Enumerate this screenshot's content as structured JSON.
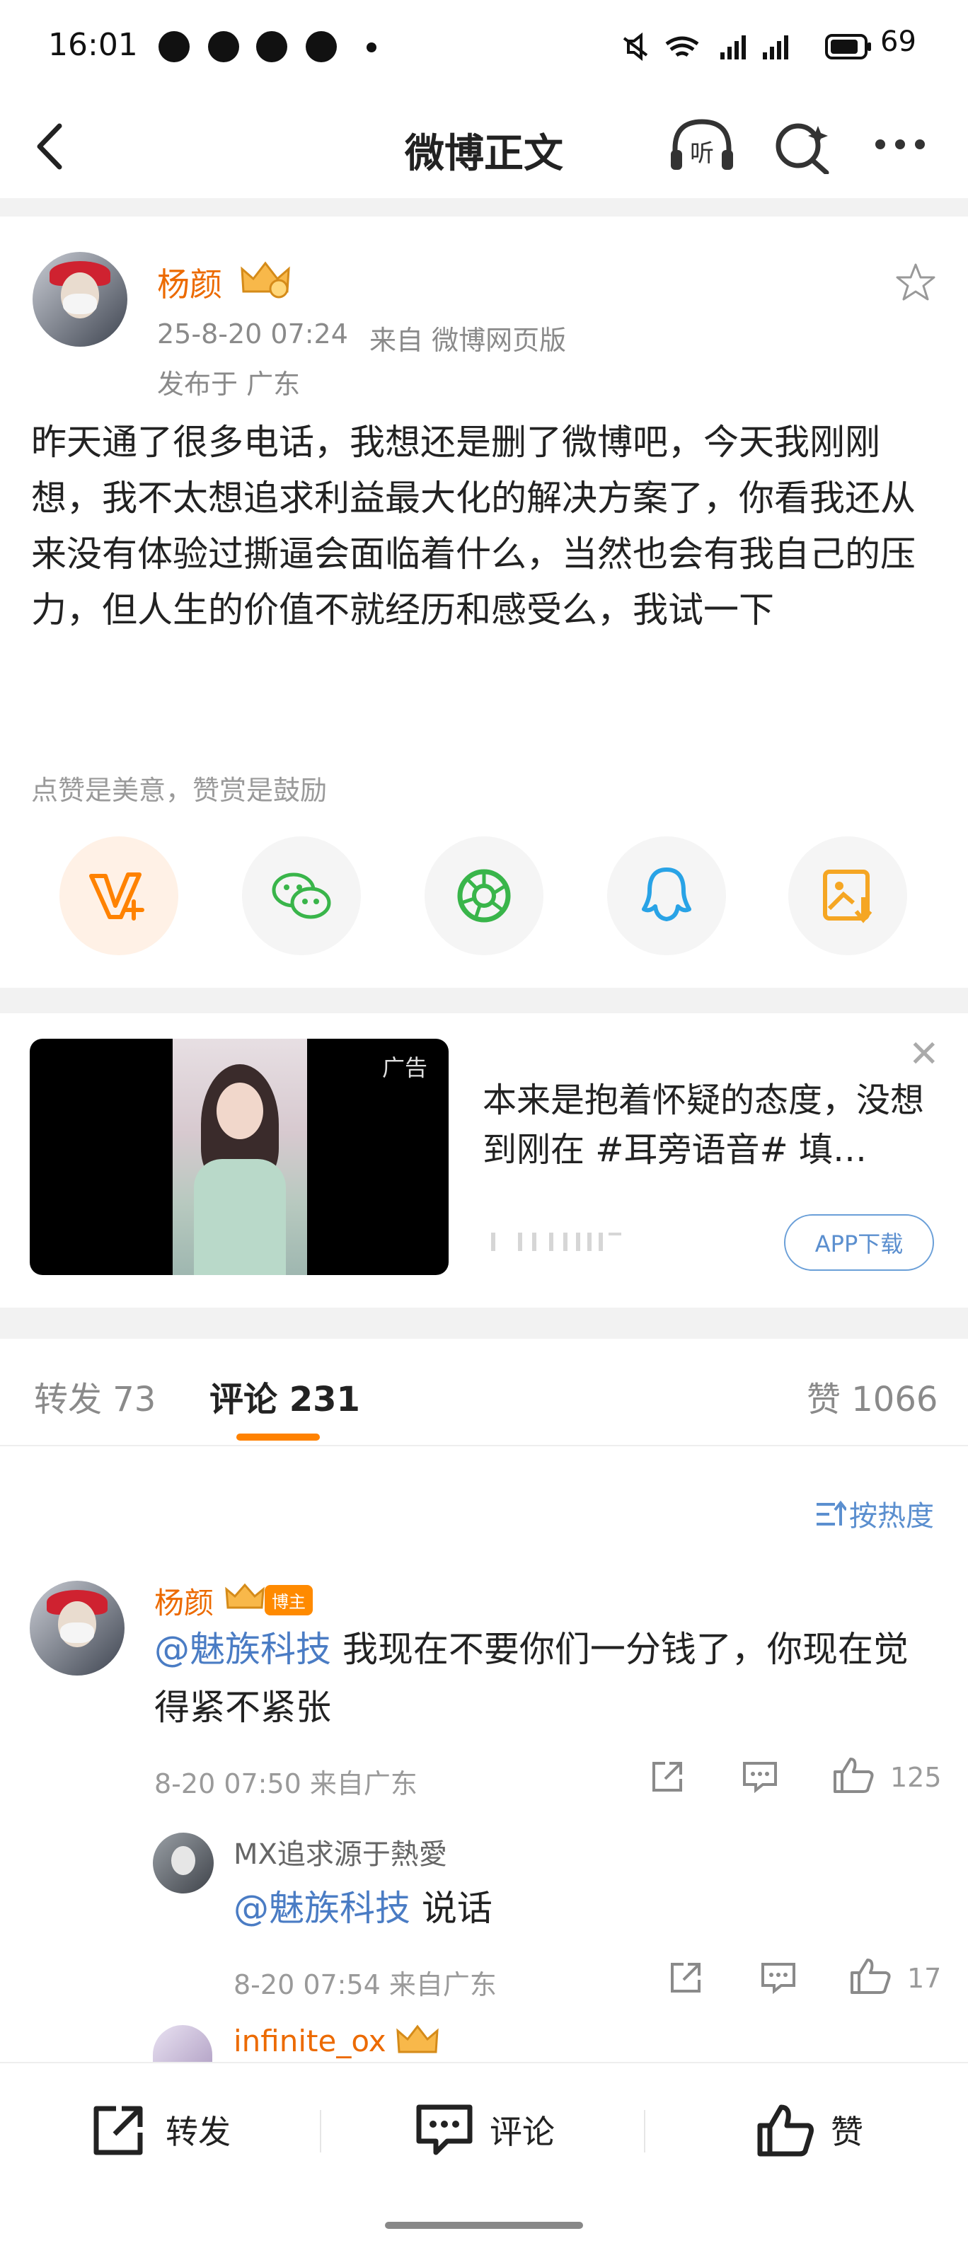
{
  "status_bar": {
    "time": "16:01",
    "battery": "69"
  },
  "nav": {
    "title": "微博正文"
  },
  "post": {
    "username": "杨颜",
    "datetime": "25-8-20 07:24",
    "source": "来自 微博网页版",
    "location": "发布于 广东",
    "content": "昨天通了很多电话，我想还是删了微博吧，今天我刚刚想，我不太想追求利益最大化的解决方案了，你看我还从来没有体验过撕逼会面临着什么，当然也会有我自己的压力，但人生的价值不就经历和感受么，我试一下",
    "reward_tip": "点赞是美意，赞赏是鼓励"
  },
  "ad": {
    "label": "广告",
    "text": "本来是抱着怀疑的态度，没想到刚在 #耳旁语音# 填…",
    "button": "APP下载"
  },
  "tabs": {
    "repost": "转发 73",
    "comment": "评论 231",
    "like": "赞 1066"
  },
  "sort_label": "按热度",
  "comments": [
    {
      "username": "杨颜",
      "badge": "博主",
      "mention": "@魅族科技",
      "text": " 我现在不要你们一分钱了，你现在觉得紧不紧张",
      "meta": "8-20 07:50  来自广东",
      "likes": "125"
    },
    {
      "username": "MX追求源于熱愛",
      "mention": "@魅族科技",
      "text": " 说话",
      "meta": "8-20 07:54  来自广东",
      "likes": "17"
    },
    {
      "username": "infinite_ox"
    }
  ],
  "bottom_bar": {
    "repost": "转发",
    "comment": "评论",
    "like": "赞"
  },
  "colors": {
    "accent": "#ff8200",
    "link": "#4a7cc4",
    "username": "#ec6a00"
  }
}
